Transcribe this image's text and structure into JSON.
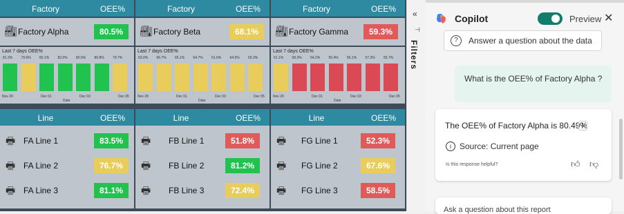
{
  "headers": {
    "factory": "Factory",
    "oee": "OEE%",
    "line": "Line"
  },
  "factories": [
    {
      "name": "Factory Alpha",
      "oee": "80.5%",
      "color": "#22c24e",
      "trend_title": "Last 7 days OEE%",
      "bar_labels": [
        "81.3%",
        "79.6%",
        "82.1%",
        "82.0%",
        "80.5%",
        "80.8%",
        "79.7%"
      ],
      "bar_values": [
        81.3,
        79.6,
        82.1,
        82.0,
        80.5,
        80.8,
        79.7
      ],
      "bar_colors": [
        "#22c24e",
        "#e8cc5c",
        "#22c24e",
        "#22c24e",
        "#22c24e",
        "#22c24e",
        "#e8cc5c"
      ],
      "axis_labels": [
        "Nov 29",
        "Dec 01",
        "Dec 03",
        "Dec 05"
      ],
      "axis_title": "Date",
      "lines": [
        {
          "name": "FA Line 1",
          "oee": "83.5%",
          "color": "#22c24e"
        },
        {
          "name": "FA Line 2",
          "oee": "76.7%",
          "color": "#e8cc5c"
        },
        {
          "name": "FA Line 3",
          "oee": "81.1%",
          "color": "#22c24e"
        }
      ]
    },
    {
      "name": "Factory Beta",
      "oee": "68.1%",
      "color": "#e8cc5c",
      "trend_title": "Last 7 days OEE%",
      "bar_labels": [
        "63.0%",
        "66.7%",
        "65.1%",
        "64.7%",
        "61.6%",
        "64.5%",
        "65.3%"
      ],
      "bar_values": [
        63.0,
        66.7,
        65.1,
        64.7,
        61.6,
        64.5,
        65.3
      ],
      "bar_colors": [
        "#e8cc5c",
        "#e8cc5c",
        "#e8cc5c",
        "#e8cc5c",
        "#e8cc5c",
        "#e8cc5c",
        "#e8cc5c"
      ],
      "axis_labels": [
        "Nov 29",
        "Dec 01",
        "Dec 03",
        "Dec 05"
      ],
      "axis_title": "Date",
      "lines": [
        {
          "name": "FB Line 1",
          "oee": "51.8%",
          "color": "#e05a5a"
        },
        {
          "name": "FB Line 2",
          "oee": "81.2%",
          "color": "#22c24e"
        },
        {
          "name": "FB Line 3",
          "oee": "72.4%",
          "color": "#e8cc5c"
        }
      ]
    },
    {
      "name": "Factory Gamma",
      "oee": "59.3%",
      "color": "#e05a5a",
      "trend_title": "Last 7 days OEE%",
      "bar_labels": [
        "61.1%",
        "58.3%",
        "54.2%",
        "55.4%",
        "56.1%",
        "57.3%",
        "55.7%"
      ],
      "bar_values": [
        61.1,
        58.3,
        54.2,
        55.4,
        56.1,
        57.3,
        55.7
      ],
      "bar_colors": [
        "#e8cc5c",
        "#d94a55",
        "#d94a55",
        "#d94a55",
        "#d94a55",
        "#d94a55",
        "#d94a55"
      ],
      "axis_labels": [
        "Nov 29",
        "Dec 01",
        "Dec 03",
        "Dec 05"
      ],
      "axis_title": "Date",
      "lines": [
        {
          "name": "FG Line 1",
          "oee": "52.3%",
          "color": "#e05a5a"
        },
        {
          "name": "FG Line 2",
          "oee": "67.6%",
          "color": "#e8cc5c"
        },
        {
          "name": "FG Line 3",
          "oee": "58.5%",
          "color": "#e05a5a"
        }
      ]
    }
  ],
  "filters": {
    "label": "Filters",
    "collapse_icon": "double-chevron-icon",
    "pin_icon": "pin-icon"
  },
  "copilot": {
    "title": "Copilot",
    "toggle_label": "Preview",
    "close_icon": "close-icon",
    "ask_button": "Answer a question about the data",
    "user_message": "What is the OEE% of Factory Alpha ?",
    "answer": "The OEE% of Factory Alpha is 80.49%",
    "reference": "1",
    "source": "Source: Current page",
    "helpful": "Is this response helpful?",
    "next_card": "Ask a question about this report"
  }
}
